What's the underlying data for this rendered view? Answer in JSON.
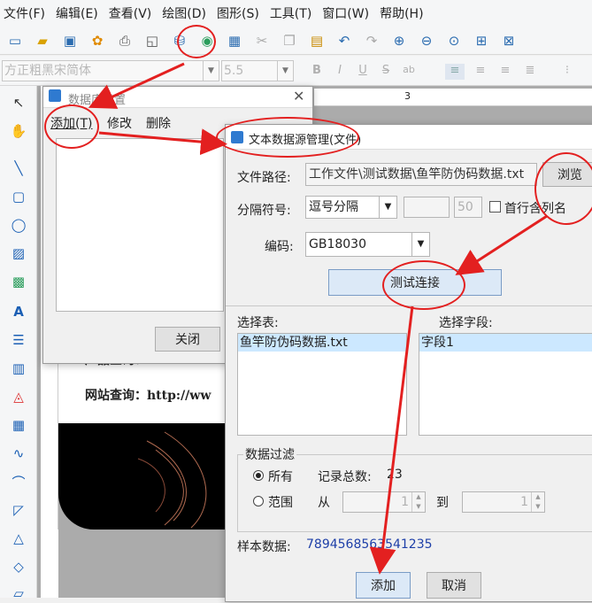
{
  "menu": [
    "文件(F)",
    "编辑(E)",
    "查看(V)",
    "绘图(D)",
    "图形(S)",
    "工具(T)",
    "窗口(W)",
    "帮助(H)"
  ],
  "fontbar": {
    "font": "方正粗黑宋简体",
    "size": "5.5"
  },
  "format_glyphs": [
    "B",
    "I",
    "U",
    "S",
    "ab"
  ],
  "canvas": {
    "ruler_mark": "3",
    "label_text_1": "产品查询：",
    "label_text_2": "网站查询：http://ww"
  },
  "ds_dialog": {
    "title": "数据库设置",
    "add": "添加(T)",
    "modify": "修改",
    "delete": "删除",
    "close": "关闭"
  },
  "text_dialog": {
    "title": "文本数据源管理(文件)",
    "path_label": "文件路径:",
    "path_value": "工作文件\\测试数据\\鱼竿防伪码数据.txt",
    "browse": "浏览",
    "sep_label": "分隔符号:",
    "sep_value": "逗号分隔",
    "sep_extra": "50",
    "first_row": "首行含列名",
    "enc_label": "编码:",
    "enc_value": "GB18030",
    "test": "测试连接",
    "table_label": "选择表:",
    "tables": [
      "鱼竿防伪码数据.txt"
    ],
    "field_label": "选择字段:",
    "fields": [
      "字段1"
    ],
    "filter_title": "数据过滤",
    "all": "所有",
    "count_label": "记录总数:",
    "count_value": "23",
    "range": "范围",
    "from": "从",
    "from_value": "1",
    "to": "到",
    "to_value": "1",
    "sample_label": "样本数据:",
    "sample_value": "7894568563541235",
    "add": "添加",
    "cancel": "取消"
  },
  "colors": {
    "annotation": "#e32020",
    "link": "#1e3fa8"
  }
}
